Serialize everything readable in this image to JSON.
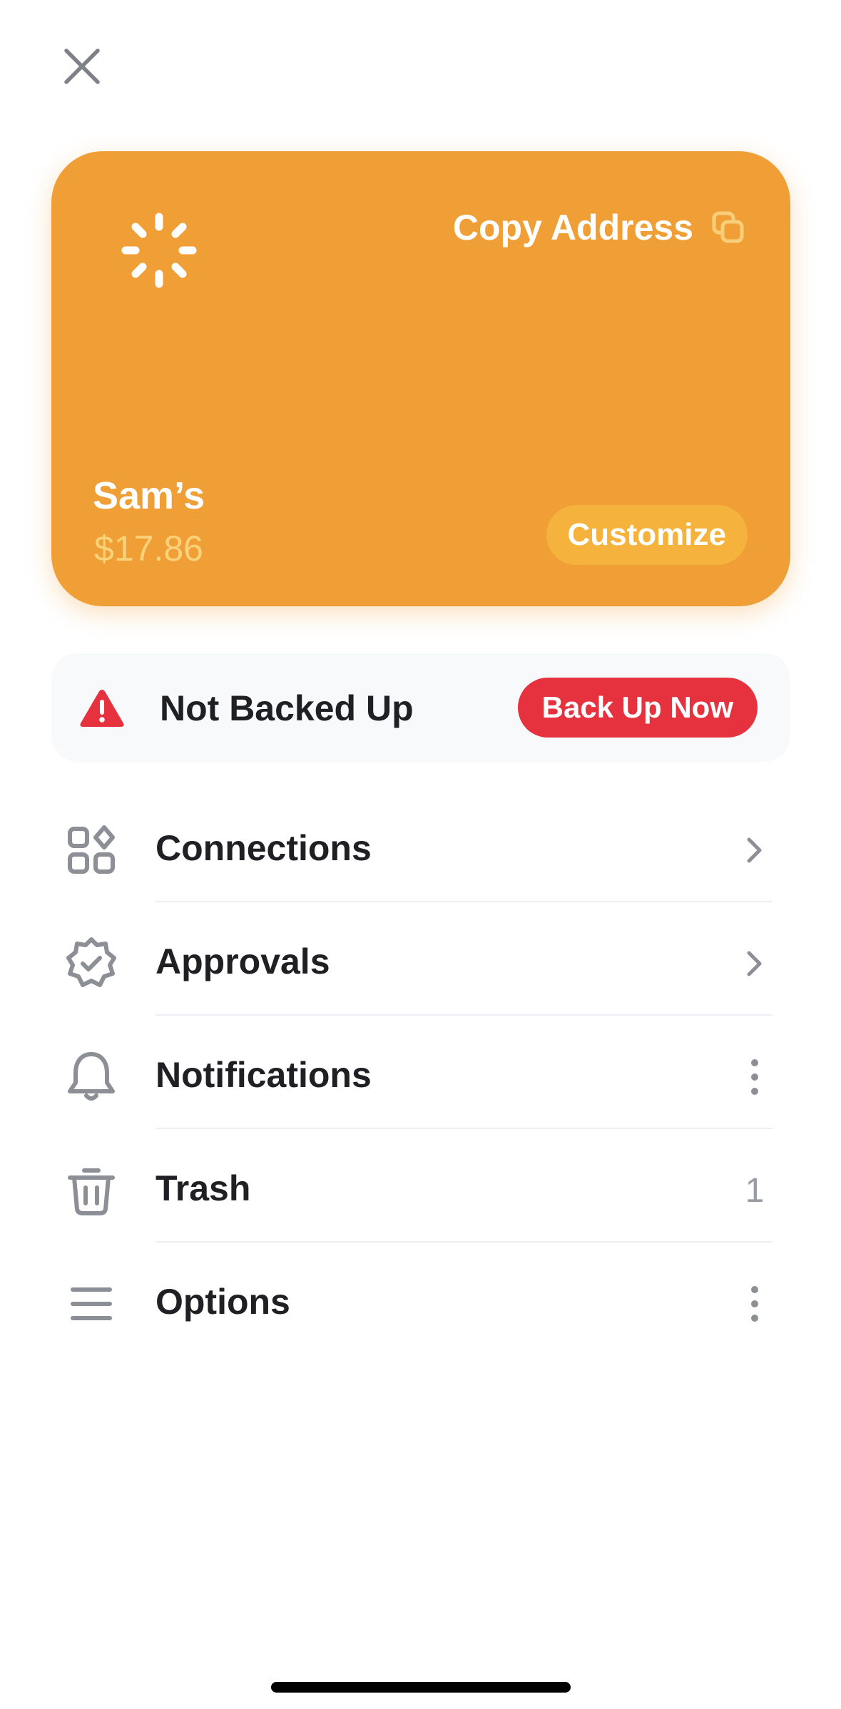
{
  "card": {
    "copy_label": "Copy Address",
    "name": "Sam’s",
    "balance": "$17.86",
    "customize_label": "Customize",
    "colors": {
      "background": "#f09f37",
      "balance": "#f9d27a",
      "customize_bg": "#f5b23c"
    }
  },
  "backup": {
    "status": "Not Backed Up",
    "action_label": "Back Up Now",
    "colors": {
      "alert": "#e5323e"
    }
  },
  "menu": [
    {
      "label": "Connections",
      "icon": "grid-icon",
      "trail": "chevron-right-icon"
    },
    {
      "label": "Approvals",
      "icon": "badge-check-icon",
      "trail": "chevron-right-icon"
    },
    {
      "label": "Notifications",
      "icon": "bell-icon",
      "trail": "more-vertical-icon"
    },
    {
      "label": "Trash",
      "icon": "trash-icon",
      "trail": "count",
      "count": "1"
    },
    {
      "label": "Options",
      "icon": "menu-lines-icon",
      "trail": "more-vertical-icon"
    }
  ]
}
